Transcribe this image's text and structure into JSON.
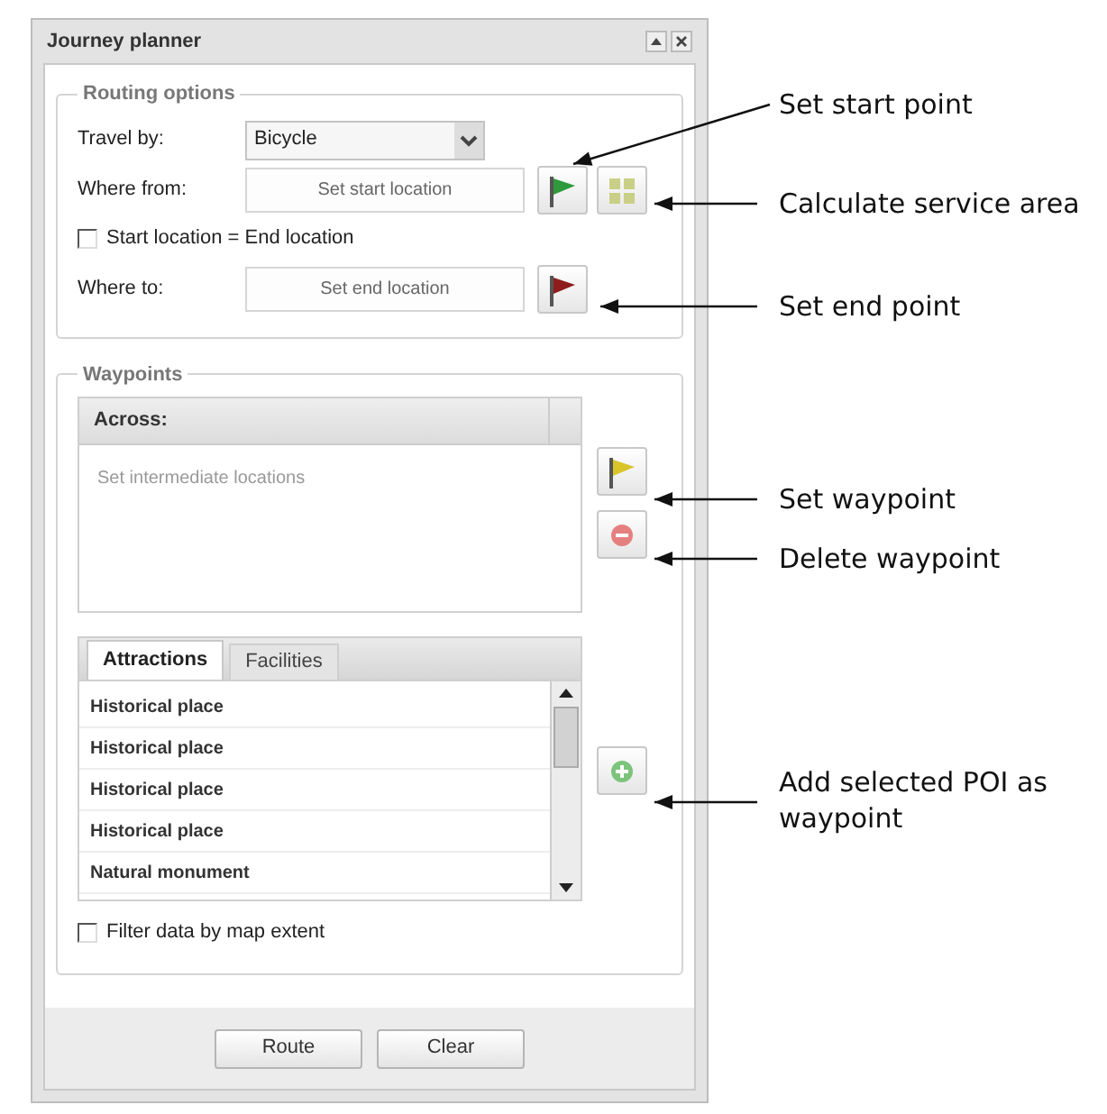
{
  "window": {
    "title": "Journey planner"
  },
  "routing_options": {
    "legend": "Routing options",
    "travel_by": {
      "label": "Travel by:",
      "value": "Bicycle"
    },
    "where_from": {
      "label": "Where from:",
      "placeholder": "Set start location"
    },
    "same_location": {
      "label": "Start location = End location",
      "checked": false
    },
    "where_to": {
      "label": "Where to:",
      "placeholder": "Set end location"
    }
  },
  "waypoints": {
    "legend": "Waypoints",
    "list_header": "Across:",
    "empty_message": "Set intermediate locations",
    "tabs": [
      {
        "label": "Attractions",
        "selected": true
      },
      {
        "label": "Facilities",
        "selected": false
      }
    ],
    "poi_rows": [
      "Historical place",
      "Historical place",
      "Historical place",
      "Historical place",
      "Natural monument"
    ],
    "filter": {
      "label": "Filter data by map extent",
      "checked": false
    }
  },
  "buttons": [
    "Route",
    "Clear"
  ],
  "annotations": [
    "Set start point",
    "Calculate service area",
    "Set end point",
    "Set waypoint",
    "Delete waypoint",
    "Add selected POI as waypoint"
  ]
}
